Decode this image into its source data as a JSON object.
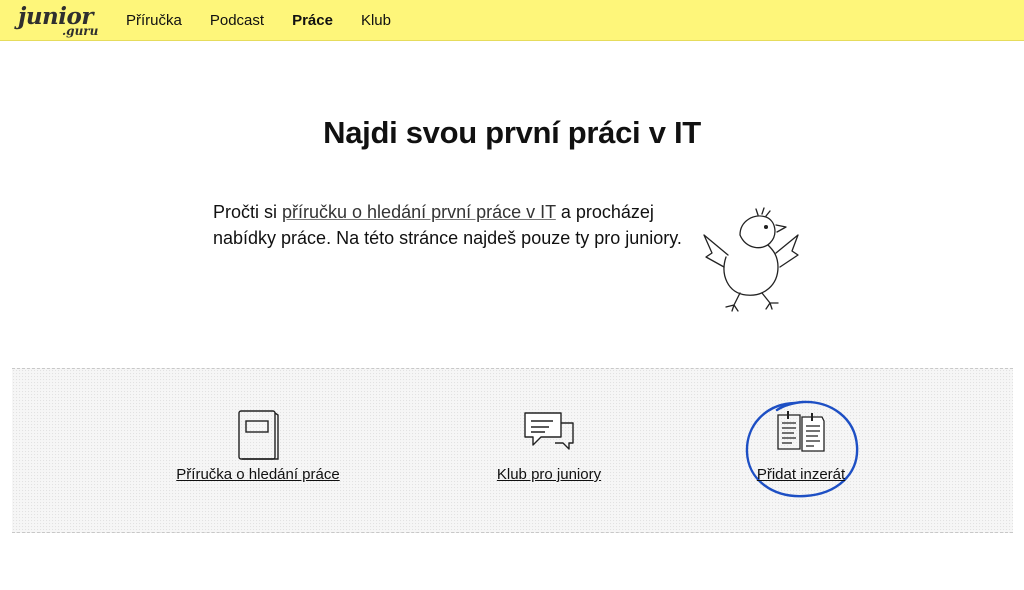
{
  "header": {
    "logo_main": "junior",
    "logo_sub": ".guru",
    "nav": [
      {
        "label": "Příručka"
      },
      {
        "label": "Podcast"
      },
      {
        "label": "Práce",
        "active": true
      },
      {
        "label": "Klub"
      }
    ]
  },
  "hero": {
    "title": "Najdi svou první práci v IT",
    "intro_before": "Pročti si ",
    "intro_link": "příručku o hledání první práce v IT",
    "intro_after": " a procházej nabídky práce. Na této stránce najdeš pouze ty pro juniory."
  },
  "cards": [
    {
      "label": "Příručka o hledání práce",
      "icon": "book-icon"
    },
    {
      "label": "Klub pro juniory",
      "icon": "chat-bubbles-icon"
    },
    {
      "label": "Přidat inzerát",
      "icon": "documents-icon",
      "highlighted": true
    }
  ],
  "colors": {
    "header_bg": "#fef67a",
    "highlight_ring": "#1d4fc4",
    "text": "#111111"
  }
}
